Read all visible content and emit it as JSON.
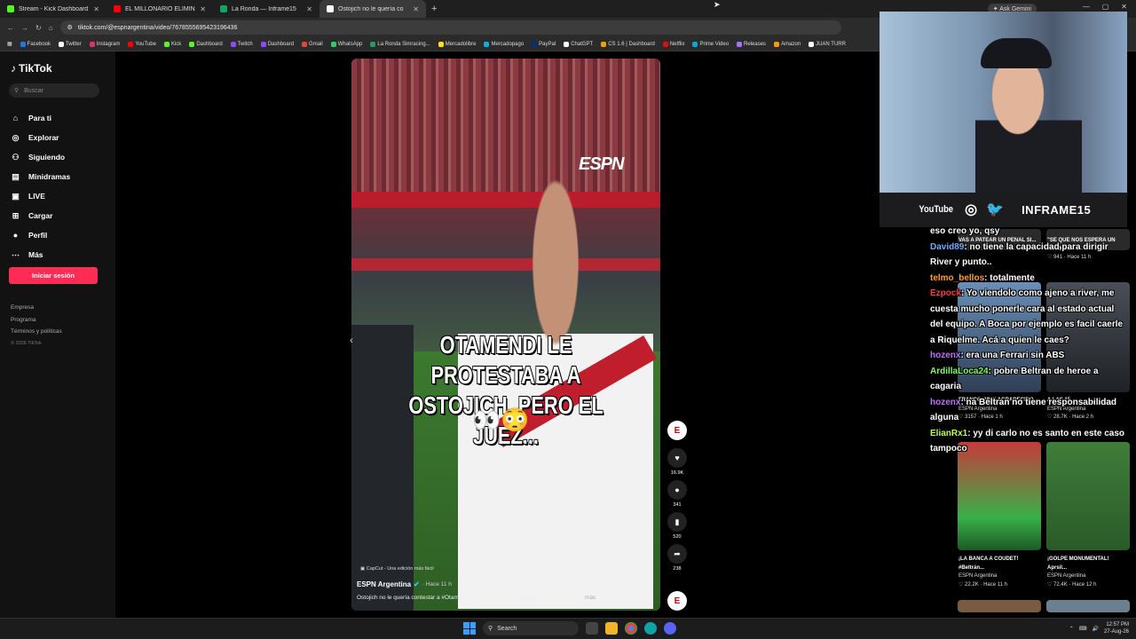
{
  "browser": {
    "tabs": [
      {
        "label": "Stream - Kick Dashboard",
        "color": "#53fc18"
      },
      {
        "label": "EL MILLONARIO ELIMINADO E",
        "color": "#ff0000"
      },
      {
        "label": "La Ronda — Inframe15",
        "color": "#1aa260"
      },
      {
        "label": "Ostojich no le quería co",
        "color": "#ffffff",
        "active": true
      }
    ],
    "url": "tiktok.com/@espnargentina/video/7678555695423196436",
    "gemini": "Ask Gemini",
    "bookmarks": [
      {
        "label": "Facebook",
        "color": "#1877f2"
      },
      {
        "label": "Twitter",
        "color": "#ffffff"
      },
      {
        "label": "Instagram",
        "color": "#e1306c"
      },
      {
        "label": "YouTube",
        "color": "#ff0000"
      },
      {
        "label": "Kick",
        "color": "#53fc18"
      },
      {
        "label": "Dashboard",
        "color": "#53fc18"
      },
      {
        "label": "Twitch",
        "color": "#9146ff"
      },
      {
        "label": "Dashboard",
        "color": "#9146ff"
      },
      {
        "label": "Gmail",
        "color": "#ea4335"
      },
      {
        "label": "WhatsApp",
        "color": "#25d366"
      },
      {
        "label": "La Ronda Simracing...",
        "color": "#1aa260"
      },
      {
        "label": "Mercadolibre",
        "color": "#ffe600"
      },
      {
        "label": "Mercadopago",
        "color": "#00b1ea"
      },
      {
        "label": "PayPal",
        "color": "#003087"
      },
      {
        "label": "ChatGPT",
        "color": "#ffffff"
      },
      {
        "label": "CS 1.6 | Dashboard",
        "color": "#f4a100"
      },
      {
        "label": "Netflix",
        "color": "#e50914"
      },
      {
        "label": "Prime Video",
        "color": "#00a8e1"
      },
      {
        "label": "Releases",
        "color": "#a970ff"
      },
      {
        "label": "Amazon",
        "color": "#ff9900"
      },
      {
        "label": "JUAN TURR",
        "color": "#ffffff"
      }
    ]
  },
  "tiktok": {
    "brand": "TikTok",
    "search_placeholder": "Buscar",
    "nav": [
      {
        "label": "Para ti",
        "icon": "home-icon",
        "glyph": "⌂"
      },
      {
        "label": "Explorar",
        "icon": "compass-icon",
        "glyph": "◎"
      },
      {
        "label": "Siguiendo",
        "icon": "following-icon",
        "glyph": "⚇"
      },
      {
        "label": "Minidramas",
        "icon": "minidramas-icon",
        "glyph": "▤"
      },
      {
        "label": "LIVE",
        "icon": "live-icon",
        "glyph": "▣"
      },
      {
        "label": "Cargar",
        "icon": "upload-icon",
        "glyph": "⊞"
      },
      {
        "label": "Perfil",
        "icon": "profile-icon",
        "glyph": "●"
      },
      {
        "label": "Más",
        "icon": "more-icon",
        "glyph": "⋯"
      }
    ],
    "login": "Iniciar sesión",
    "footer": [
      "Empresa",
      "Programa",
      "Términos y políticas"
    ],
    "copyright": "© 2026 TikTok",
    "accent": "#fe2c55"
  },
  "video": {
    "watermark": "ESPN",
    "caption": "OTAMENDI LE PROTESTABA A OSTOJICH, PERO EL JUEZ...",
    "emoji": "👀😳",
    "capcut": "CapCut - Una edición más fácil",
    "author": "ESPN Argentina",
    "time": "Hace 11 h",
    "description": "Ostojich no le quería contestar a #Otamendi por la protesta del capitán de #River ante ...",
    "more": "más",
    "likes": "16.9K",
    "comments": "341",
    "saves": "520",
    "shares": "238"
  },
  "stream": {
    "social_youtube": "YouTube",
    "handle": "INFRAME15"
  },
  "thumbs": [
    {
      "title": "VAS A PATEAR UN PENAL SI...",
      "author": "",
      "stats": "",
      "time": ""
    },
    {
      "title": "\"SE QUE NOS ESPERA UN GRAN...",
      "author": "",
      "stats": "941",
      "time": "Hace 11 h"
    },
    {
      "title": "FRANCO, MUY AGRADECIDO...",
      "author": "ESPN Argentina",
      "stats": "3157",
      "time": "Hace 1 h"
    },
    {
      "title": "A LAS 15...",
      "author": "ESPN Argentina",
      "stats": "28.7K",
      "time": "Hace 2 h"
    },
    {
      "title": "¡LA BANCA A COUDET! #Beltrán...",
      "author": "ESPN Argentina",
      "stats": "22.2K",
      "time": "Hace 11 h"
    },
    {
      "title": "¡GOLPE MONUMENTAL! Aprsil...",
      "author": "ESPN Argentina",
      "stats": "72.4K",
      "time": "Hace 12 h"
    }
  ],
  "chat": [
    {
      "user": "",
      "color": "#ffffff",
      "text": "eso creo yo, qsy"
    },
    {
      "user": "David89",
      "color": "#6fa8ff",
      "text": ": no tiene la capacidad para dirigir River y punto.."
    },
    {
      "user": "telmo_bellos",
      "color": "#ff9d2e",
      "text": ": totalmente"
    },
    {
      "user": "Ezpock",
      "color": "#ff3b3b",
      "text": ": Yo viendolo como ajeno a river, me cuesta mucho ponerle cara al estado actual del equipo. A Boca por ejemplo es facil caerle a Riquelme. Acá a quien le caes?"
    },
    {
      "user": "hozenx",
      "color": "#c070ff",
      "text": ": era una Ferrari sin ABS"
    },
    {
      "user": "ArdillaLoca24",
      "color": "#7cff5a",
      "text": ": pobre Beltran de heroe a cagaria"
    },
    {
      "user": "hozenx",
      "color": "#c070ff",
      "text": ": na Beltran no tiene responsabilidad alguna"
    },
    {
      "user": "ElianRx1",
      "color": "#b8ff4a",
      "text": ": yy di carlo no es santo en este caso tampoco"
    }
  ],
  "taskbar": {
    "search": "Search",
    "time": "12:57 PM",
    "date": "27-Aug-26"
  }
}
